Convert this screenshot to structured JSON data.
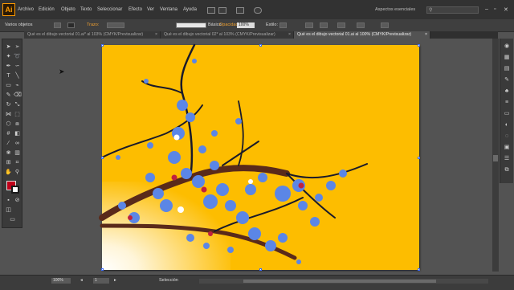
{
  "app": {
    "logo": "Ai"
  },
  "menu": {
    "items": [
      "Archivo",
      "Edición",
      "Objeto",
      "Texto",
      "Seleccionar",
      "Efecto",
      "Ver",
      "Ventana",
      "Ayuda"
    ],
    "workspace": "Aspectos esenciales",
    "window_controls": [
      "minimize-icon",
      "restore-icon",
      "close-icon"
    ]
  },
  "control": {
    "selection_label": "Varios objetos",
    "fill_label": "Trazo:",
    "stroke_profile": "Básico",
    "opacity_label": "Opacidad:",
    "opacity_value": "100%",
    "style_label": "Estilo:"
  },
  "tabs": [
    {
      "label": "Qué es el dibujo vectorial 01.ai* al 103% (CMYK/Previsualizar)",
      "active": false
    },
    {
      "label": "Qué es el dibujo vectorial 02* al 103% (CMYK/Previsualizar)",
      "active": false
    },
    {
      "label": "Qué es el dibujo vectorial 01.ai al 100% (CMYK/Previsualizar)",
      "active": true
    }
  ],
  "artboard": {
    "background_color": "#fdbd00",
    "branch_color": "#5a2a1a",
    "blossom_color": "#5b86e6",
    "accent_color": "#c0213e"
  },
  "status": {
    "zoom": "100%",
    "page": "1",
    "tool": "Selección"
  },
  "colors": {
    "fill": "#c0001a",
    "stroke": "#ffffff"
  }
}
